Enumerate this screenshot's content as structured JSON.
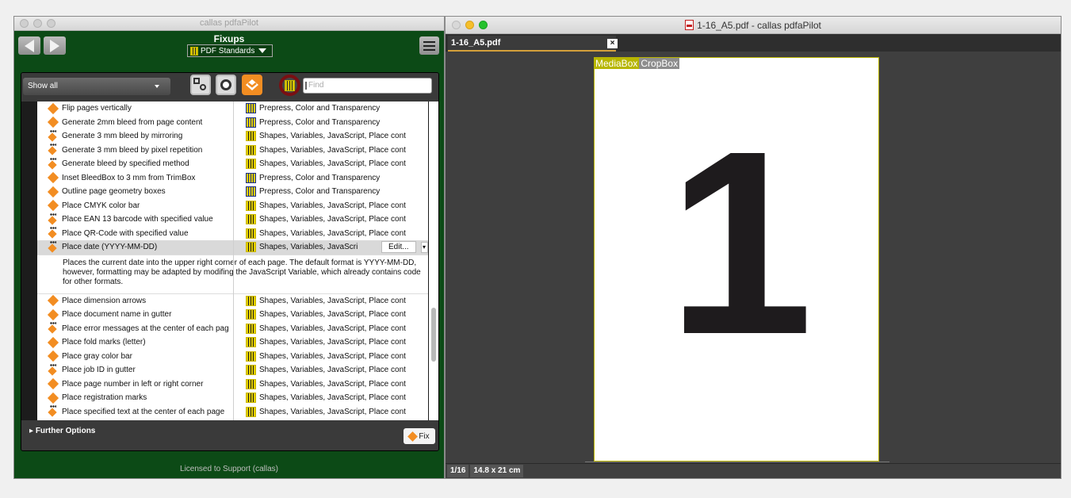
{
  "left_window": {
    "title": "callas pdfaPilot",
    "header": {
      "title": "Fixups",
      "standard_select": "PDF Standards"
    },
    "filter": {
      "show_select": "Show all",
      "find_placeholder": "Find"
    },
    "rows_top": [
      {
        "name": "Flip pages vertically",
        "library": "Prepress, Color and Transparency",
        "icon": "fixup-icon",
        "lib_color": "blue"
      },
      {
        "name": "Generate 2mm bleed from page content",
        "library": "Prepress, Color and Transparency",
        "icon": "fixup-icon",
        "lib_color": "blue"
      },
      {
        "name": "Generate 3 mm bleed by mirroring",
        "library": "Shapes, Variables, JavaScript, Place cont",
        "icon": "fixup-variable-icon",
        "lib_color": "dark"
      },
      {
        "name": "Generate 3 mm bleed by pixel repetition",
        "library": "Shapes, Variables, JavaScript, Place cont",
        "icon": "fixup-variable-icon",
        "lib_color": "dark"
      },
      {
        "name": "Generate bleed by specified method",
        "library": "Shapes, Variables, JavaScript, Place cont",
        "icon": "fixup-variable-icon",
        "lib_color": "dark"
      },
      {
        "name": "Inset BleedBox to 3 mm from TrimBox",
        "library": "Prepress, Color and Transparency",
        "icon": "fixup-icon",
        "lib_color": "blue"
      },
      {
        "name": "Outline page geometry boxes",
        "library": "Prepress, Color and Transparency",
        "icon": "fixup-icon",
        "lib_color": "blue"
      },
      {
        "name": "Place CMYK color bar",
        "library": "Shapes, Variables, JavaScript, Place cont",
        "icon": "fixup-icon",
        "lib_color": "dark"
      },
      {
        "name": "Place EAN 13 barcode with specified value",
        "library": "Shapes, Variables, JavaScript, Place cont",
        "icon": "fixup-variable-icon",
        "lib_color": "dark"
      },
      {
        "name": "Place QR-Code with specified value",
        "library": "Shapes, Variables, JavaScript, Place cont",
        "icon": "fixup-variable-icon",
        "lib_color": "dark"
      }
    ],
    "selected_row": {
      "name": "Place date (YYYY-MM-DD)",
      "library": "Shapes, Variables, JavaScri",
      "edit_label": "Edit...",
      "description": "Places the current date into the upper right corner of each page. The default format is YYYY-MM-DD, however, formatting may be adapted by modifing the JavaScript Variable, which already contains code for other formats."
    },
    "rows_bottom": [
      {
        "name": "Place dimension arrows",
        "library": "Shapes, Variables, JavaScript, Place cont",
        "icon": "fixup-icon",
        "lib_color": "dark"
      },
      {
        "name": "Place document name in gutter",
        "library": "Shapes, Variables, JavaScript, Place cont",
        "icon": "fixup-icon",
        "lib_color": "dark"
      },
      {
        "name": "Place error messages at the center of each pag",
        "library": "Shapes, Variables, JavaScript, Place cont",
        "icon": "fixup-variable-icon",
        "lib_color": "dark"
      },
      {
        "name": "Place fold marks (letter)",
        "library": "Shapes, Variables, JavaScript, Place cont",
        "icon": "fixup-icon",
        "lib_color": "dark"
      },
      {
        "name": "Place gray color bar",
        "library": "Shapes, Variables, JavaScript, Place cont",
        "icon": "fixup-icon",
        "lib_color": "dark"
      },
      {
        "name": "Place job ID in gutter",
        "library": "Shapes, Variables, JavaScript, Place cont",
        "icon": "fixup-variable-icon",
        "lib_color": "dark"
      },
      {
        "name": "Place page number in left or right corner",
        "library": "Shapes, Variables, JavaScript, Place cont",
        "icon": "fixup-icon",
        "lib_color": "dark"
      },
      {
        "name": "Place registration marks",
        "library": "Shapes, Variables, JavaScript, Place cont",
        "icon": "fixup-icon",
        "lib_color": "dark"
      },
      {
        "name": "Place specified text at the center of each page",
        "library": "Shapes, Variables, JavaScript, Place cont",
        "icon": "fixup-variable-icon",
        "lib_color": "dark"
      }
    ],
    "further_options": "Further Options",
    "fix_button": "Fix",
    "license": "Licensed to Support (callas)"
  },
  "right_window": {
    "title": "1-16_A5.pdf - callas pdfaPilot",
    "tab": "1-16_A5.pdf",
    "tab_close": "×",
    "box_labels": {
      "mediabox": "MediaBox",
      "cropbox": "CropBox"
    },
    "page_content": "1",
    "status": {
      "page": "1/16",
      "size": "14.8 x 21 cm"
    }
  },
  "colors": {
    "panel_green": "#0c4a16",
    "fixup_orange": "#f28d22",
    "library_yellow": "#e3cf00",
    "highlight_ring": "#7a0f12",
    "mediabox_olive": "#b7b600"
  }
}
